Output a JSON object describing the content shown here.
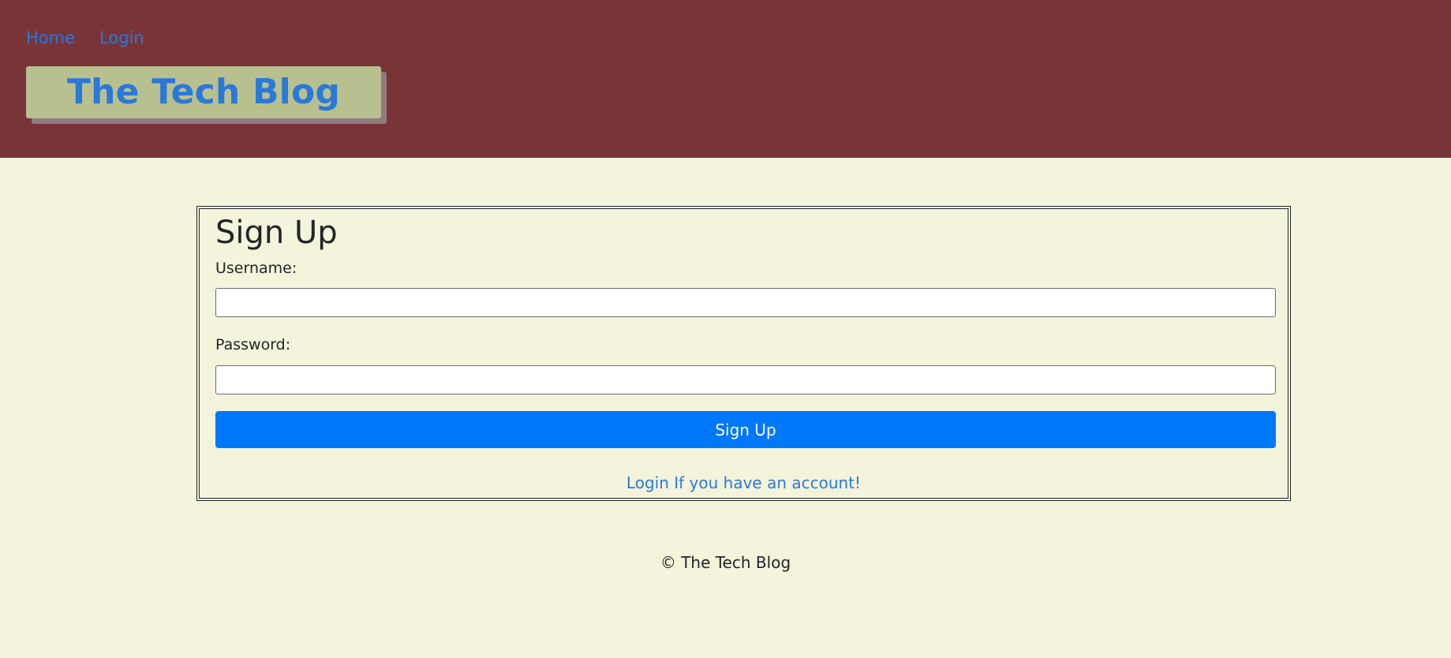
{
  "nav": {
    "home_label": "Home",
    "login_label": "Login"
  },
  "brand": {
    "title": "The Tech Blog"
  },
  "signup": {
    "heading": "Sign Up",
    "username_label": "Username:",
    "username_value": "",
    "password_label": "Password:",
    "password_value": "",
    "submit_label": "Sign Up",
    "login_link": "Login If you have an account!"
  },
  "footer": {
    "copyright": "© The Tech Blog"
  },
  "colors": {
    "header_bg": "#793438",
    "page_bg": "#f4f4dc",
    "brand_bg": "#b9c08f",
    "link": "#2a79d8",
    "button": "#0078fc"
  }
}
